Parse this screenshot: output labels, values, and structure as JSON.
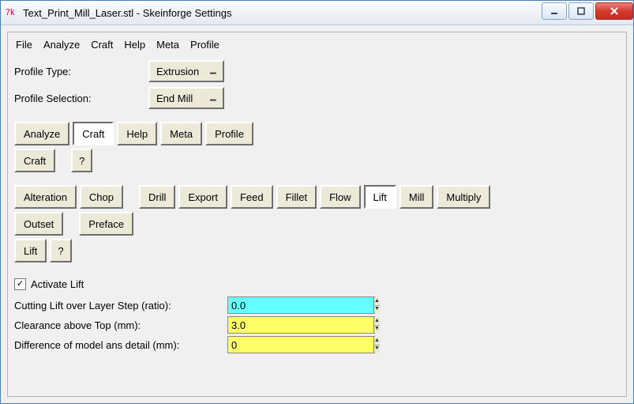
{
  "window": {
    "title": "Text_Print_Mill_Laser.stl - Skeinforge Settings"
  },
  "menu": {
    "items": [
      "File",
      "Analyze",
      "Craft",
      "Help",
      "Meta",
      "Profile"
    ]
  },
  "profile": {
    "type_label": "Profile Type:",
    "type_value": "Extrusion",
    "selection_label": "Profile Selection:",
    "selection_value": "End Mill"
  },
  "top_tabs": {
    "items": [
      "Analyze",
      "Craft",
      "Help",
      "Meta",
      "Profile"
    ],
    "selected_index": 1
  },
  "craft_bar": {
    "main": "Craft",
    "help": "?"
  },
  "plugin_tabs": {
    "row1": [
      "Alteration",
      "Chop",
      "Drill",
      "Export",
      "Feed",
      "Fillet",
      "Flow",
      "Lift",
      "Mill",
      "Multiply"
    ],
    "row2": [
      "Outset",
      "Preface"
    ],
    "selected_label": "Lift"
  },
  "lift_bar": {
    "main": "Lift",
    "help": "?"
  },
  "activate": {
    "label": "Activate Lift",
    "checked": true
  },
  "fields": {
    "cutting_lift": {
      "label": "Cutting Lift over Layer Step (ratio):",
      "value": "0.0",
      "color": "cyan"
    },
    "clearance": {
      "label": "Clearance above Top (mm):",
      "value": "3.0",
      "color": "yellow"
    },
    "difference": {
      "label": "Difference of model ans detail (mm):",
      "value": "0",
      "color": "yellow"
    }
  }
}
